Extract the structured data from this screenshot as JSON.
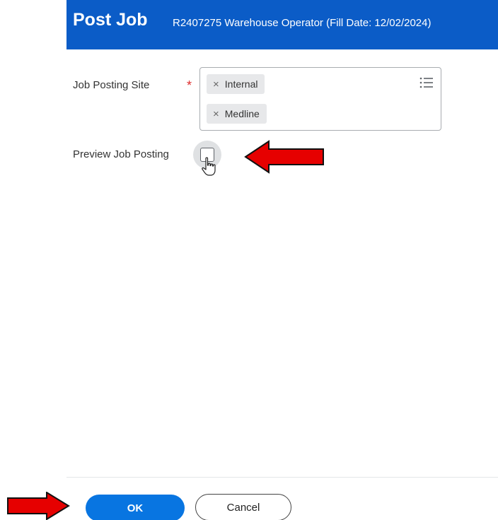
{
  "header": {
    "title": "Post Job",
    "subtitle": "R2407275 Warehouse Operator (Fill Date: 12/02/2024)"
  },
  "form": {
    "job_posting_site": {
      "label": "Job Posting Site",
      "required_mark": "*",
      "selected": [
        {
          "remove": "×",
          "label": "Internal"
        },
        {
          "remove": "×",
          "label": "Medline"
        }
      ],
      "icon": "list-icon"
    },
    "preview_job_posting": {
      "label": "Preview Job Posting",
      "checked": false
    }
  },
  "footer": {
    "ok_label": "OK",
    "cancel_label": "Cancel"
  },
  "annotations": {
    "arrow_color": "#e60000"
  },
  "colors": {
    "header_bg": "#0b5cc7",
    "primary_button": "#0875e1",
    "required": "#de2d2d"
  }
}
